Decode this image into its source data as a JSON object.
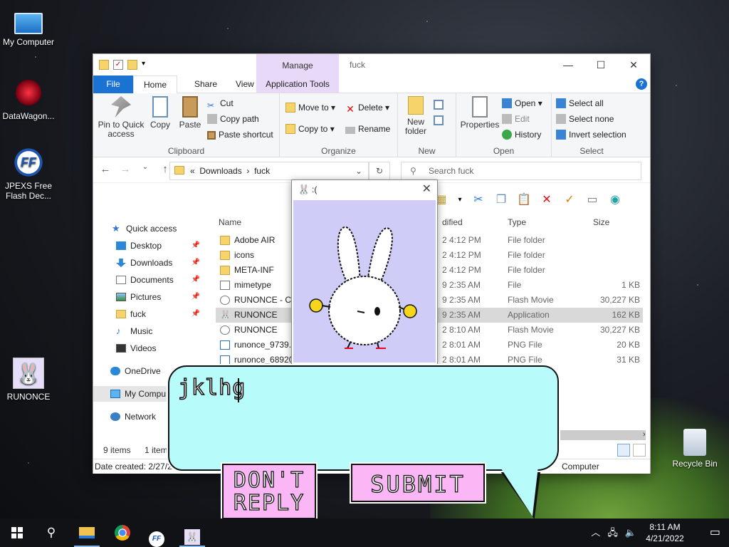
{
  "desktop": {
    "icons": [
      {
        "label": "My Computer"
      },
      {
        "label": "DataWagon..."
      },
      {
        "label": "JPEXS Free Flash Dec..."
      },
      {
        "label": "RUNONCE"
      },
      {
        "label": "Recycle Bin"
      }
    ]
  },
  "explorer": {
    "title": "fuck",
    "manage_tab": "Manage",
    "window_controls": {
      "minimize": "—",
      "maximize": "☐",
      "close": "✕"
    },
    "ribbon_tabs": [
      "File",
      "Home",
      "Share",
      "View",
      "Application Tools"
    ],
    "help": "?",
    "ribbon": {
      "clipboard": {
        "label": "Clipboard",
        "pin": "Pin to Quick access",
        "copy": "Copy",
        "paste": "Paste",
        "cut": "Cut",
        "copy_path": "Copy path",
        "paste_shortcut": "Paste shortcut"
      },
      "organize": {
        "label": "Organize",
        "move_to": "Move to ▾",
        "copy_to": "Copy to ▾",
        "delete": "Delete ▾",
        "rename": "Rename"
      },
      "new": {
        "label": "New",
        "new_folder": "New folder"
      },
      "open": {
        "label": "Open",
        "properties": "Properties",
        "open": "Open ▾",
        "edit": "Edit",
        "history": "History"
      },
      "select": {
        "label": "Select",
        "select_all": "Select all",
        "select_none": "Select none",
        "invert": "Invert selection"
      }
    },
    "address": {
      "prefix": "«",
      "path1": "Downloads",
      "sep": "›",
      "path2": "fuck",
      "search_placeholder": "Search fuck"
    },
    "nav": [
      {
        "label": "Quick access"
      },
      {
        "label": "Desktop"
      },
      {
        "label": "Downloads"
      },
      {
        "label": "Documents"
      },
      {
        "label": "Pictures"
      },
      {
        "label": "fuck"
      },
      {
        "label": "Music"
      },
      {
        "label": "Videos"
      },
      {
        "label": "OneDrive"
      },
      {
        "label": "My Compu"
      },
      {
        "label": "Network"
      }
    ],
    "columns": {
      "name": "Name",
      "modified": "dified",
      "type": "Type",
      "size": "Size"
    },
    "files": [
      {
        "name": "Adobe AIR",
        "modified": "2 4:12 PM",
        "type": "File folder",
        "size": ""
      },
      {
        "name": "icons",
        "modified": "2 4:12 PM",
        "type": "File folder",
        "size": ""
      },
      {
        "name": "META-INF",
        "modified": "2 4:12 PM",
        "type": "File folder",
        "size": ""
      },
      {
        "name": "mimetype",
        "modified": "9 2:35 AM",
        "type": "File",
        "size": "1 KB"
      },
      {
        "name": "RUNONCE - Co",
        "modified": "9 2:35 AM",
        "type": "Flash Movie",
        "size": "30,227 KB"
      },
      {
        "name": "RUNONCE",
        "modified": "9 2:35 AM",
        "type": "Application",
        "size": "162 KB"
      },
      {
        "name": "RUNONCE",
        "modified": "2 8:10 AM",
        "type": "Flash Movie",
        "size": "30,227 KB"
      },
      {
        "name": "runonce_9739.6",
        "modified": "2 8:01 AM",
        "type": "PNG File",
        "size": "20 KB"
      },
      {
        "name": "runonce_68920.",
        "modified": "2 8:01 AM",
        "type": "PNG File",
        "size": "31 KB"
      }
    ],
    "status": {
      "count": "9 items",
      "selected": "1 item"
    },
    "details": {
      "created": "Date created: 2/27/20",
      "location": "Computer"
    }
  },
  "popup": {
    "title": ":(",
    "close": "✕"
  },
  "dialog": {
    "input_text": "jklhg",
    "dont_reply_line1": "DON'T",
    "dont_reply_line2": "REPLY",
    "submit": "SUBMIT"
  },
  "taskbar": {
    "time": "8:11 AM",
    "date": "4/21/2022"
  }
}
